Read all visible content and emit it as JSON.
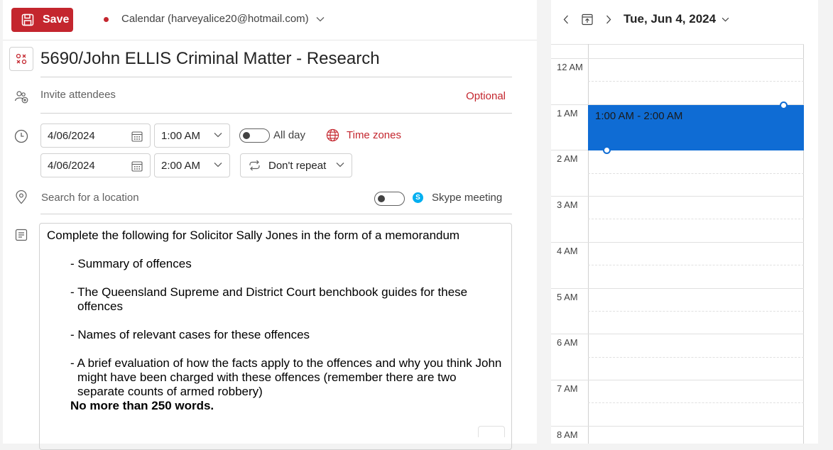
{
  "toolbar": {
    "save_label": "Save",
    "calendar_label": "Calendar (harveyalice20@hotmail.com)",
    "accent": "#c4262e"
  },
  "event": {
    "title": "5690/John ELLIS Criminal Matter - Research",
    "invite_placeholder": "Invite attendees",
    "optional_label": "Optional",
    "start_date": "4/06/2024",
    "start_time": "1:00 AM",
    "end_date": "4/06/2024",
    "end_time": "2:00 AM",
    "all_day_label": "All day",
    "all_day_on": false,
    "time_zones_label": "Time zones",
    "repeat_label": "Don't repeat",
    "location_placeholder": "Search for a location",
    "skype_label": "Skype meeting",
    "skype_on": false
  },
  "body": {
    "intro": "Complete the following for Solicitor Sally Jones in the form of a memorandum",
    "items": [
      "- Summary of offences",
      "- The Queensland Supreme and District Court benchbook guides for these offences",
      "- Names of relevant cases for these offences",
      "- A brief evaluation of how the facts apply to the offences and why you think John might have been charged with these offences (remember there are two separate counts of armed robbery)"
    ],
    "bold_note": "No more than 250 words."
  },
  "day_view": {
    "date_title": "Tue, Jun 4, 2024",
    "hours": [
      "12 AM",
      "1 AM",
      "2 AM",
      "3 AM",
      "4 AM",
      "5 AM",
      "6 AM",
      "7 AM",
      "8 AM"
    ],
    "event_label": "1:00 AM - 2:00 AM",
    "event_color": "#0f6cd4"
  }
}
